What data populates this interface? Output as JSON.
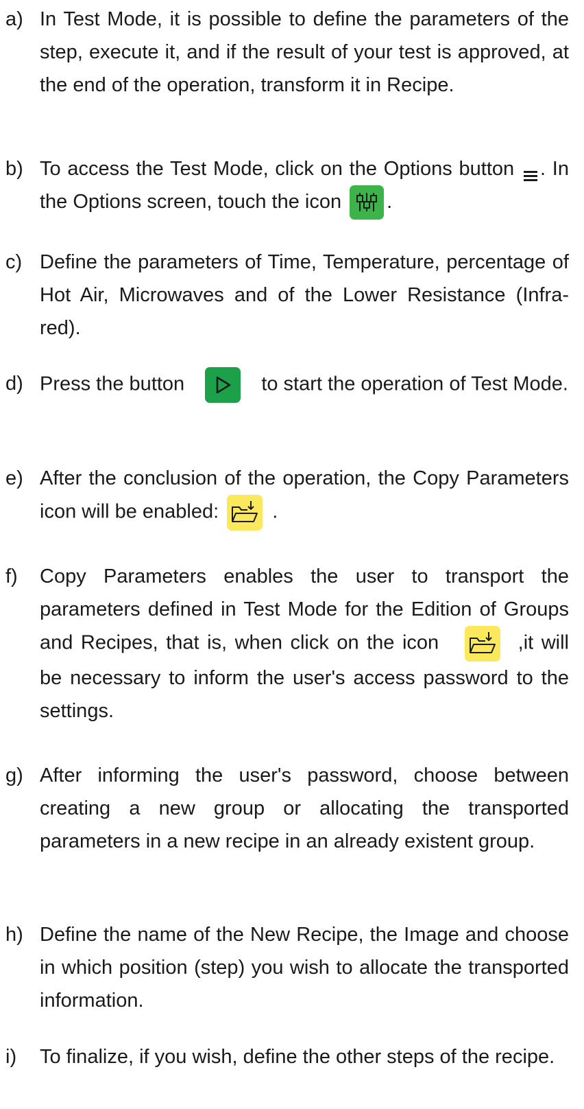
{
  "items": [
    {
      "marker": "a)",
      "lines": [
        "In Test Mode, it is possible to define the parameters of the step, execute it, and if the result of your test is approved, at the end of the operation, transform it in Recipe."
      ]
    },
    {
      "marker": "b)",
      "text_1": "To access the Test Mode, click on the Options button",
      "text_2": ". In the Options screen, touch the icon",
      "text_3": "."
    },
    {
      "marker": "c)",
      "text": "Define the parameters of Time, Temperature, percentage of Hot Air, Microwaves and of the Lower Resistance (Infra-red)."
    },
    {
      "marker": "d)",
      "text_1": "Press the button",
      "text_2": "to start the operation of Test Mode."
    },
    {
      "marker": "e)",
      "text_1": "After the conclusion of the operation, the Copy Parameters icon will be enabled:",
      "text_2": "."
    },
    {
      "marker": "f)",
      "text_1": "Copy Parameters enables the user to transport the parameters defined in Test Mode for the Edition of Groups and Recipes, that is, when click on the icon",
      "text_2": ",it will be necessary to inform the user's access password to the settings."
    },
    {
      "marker": "g)",
      "text": "After informing the user's password, choose between creating a new group or allocating the transported parameters in a new recipe in an already existent group."
    },
    {
      "marker": "h)",
      "text": "Define the name of the New Recipe, the Image and choose in which position (step) you wish to allocate the transported information."
    },
    {
      "marker": "i)",
      "text": "To finalize, if you wish, define the other steps of the recipe."
    }
  ],
  "icons": {
    "options_menu": "menu-icon",
    "test_mode": "sliders-icon",
    "start": "play-icon",
    "copy_parameters": "folder-download-icon",
    "green": "#3cb44a",
    "yellow": "#fbe85c"
  }
}
